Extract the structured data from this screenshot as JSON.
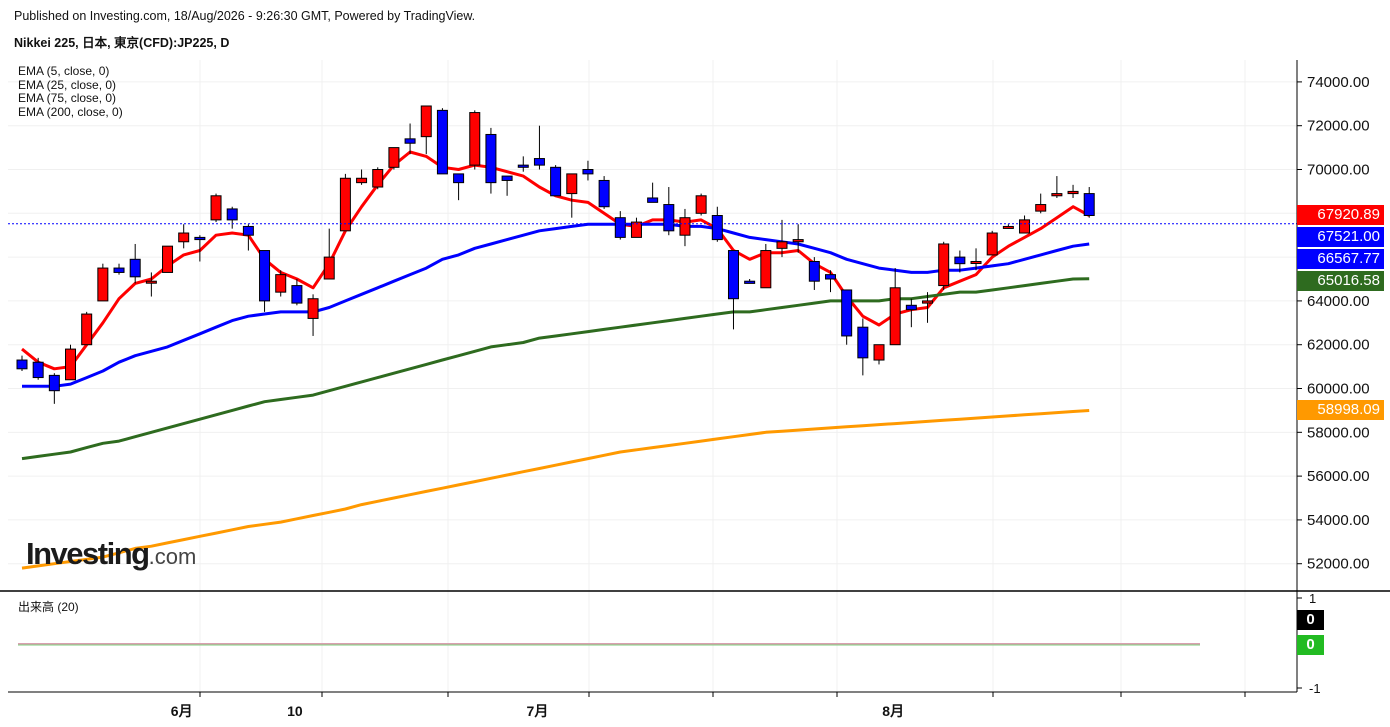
{
  "header": {
    "published": "Published on Investing.com, 18/Aug/2026 - 9:26:30 GMT, Powered by TradingView.",
    "symbol": "Nikkei 225, 日本, 東京(CFD):JP225, D"
  },
  "logo": {
    "text": "Investing",
    "suffix": ".com"
  },
  "chart_data": {
    "type": "candlestick",
    "y_axis": {
      "range": [
        50800,
        75000
      ],
      "ticks": [
        52000,
        54000,
        56000,
        58000,
        60000,
        62000,
        64000,
        66000,
        68000,
        70000,
        72000,
        74000
      ],
      "tick_labels": [
        "52000.00",
        "54000.00",
        "56000.00",
        "58000.00",
        "60000.00",
        "62000.00",
        "64000.00",
        "66000.00",
        "68000.00",
        "70000.00",
        "72000.00",
        "74000.00"
      ]
    },
    "x_axis": {
      "labels": [
        {
          "text": "6月",
          "index": 10
        },
        {
          "text": "10",
          "index": 17
        },
        {
          "text": "7月",
          "index": 32
        },
        {
          "text": "8月",
          "index": 54
        }
      ]
    },
    "candles": [
      {
        "o": 61300,
        "h": 61500,
        "l": 60800,
        "c": 60900
      },
      {
        "o": 61200,
        "h": 61400,
        "l": 60400,
        "c": 60500
      },
      {
        "o": 60600,
        "h": 60700,
        "l": 59300,
        "c": 59900
      },
      {
        "o": 60400,
        "h": 62000,
        "l": 60400,
        "c": 61800
      },
      {
        "o": 62000,
        "h": 63500,
        "l": 62000,
        "c": 63400
      },
      {
        "o": 64000,
        "h": 65700,
        "l": 64000,
        "c": 65500
      },
      {
        "o": 65500,
        "h": 65700,
        "l": 65200,
        "c": 65300
      },
      {
        "o": 65900,
        "h": 66600,
        "l": 64800,
        "c": 65100
      },
      {
        "o": 64900,
        "h": 65300,
        "l": 64200,
        "c": 64900
      },
      {
        "o": 65300,
        "h": 66400,
        "l": 65300,
        "c": 66500
      },
      {
        "o": 66700,
        "h": 67500,
        "l": 66400,
        "c": 67100
      },
      {
        "o": 66900,
        "h": 67000,
        "l": 65800,
        "c": 66800
      },
      {
        "o": 67700,
        "h": 68900,
        "l": 67600,
        "c": 68800
      },
      {
        "o": 68200,
        "h": 68300,
        "l": 67300,
        "c": 67700
      },
      {
        "o": 67400,
        "h": 67500,
        "l": 66300,
        "c": 67000
      },
      {
        "o": 66300,
        "h": 66300,
        "l": 63500,
        "c": 64000
      },
      {
        "o": 64400,
        "h": 65400,
        "l": 64200,
        "c": 65200
      },
      {
        "o": 64700,
        "h": 65000,
        "l": 63800,
        "c": 63900
      },
      {
        "o": 63200,
        "h": 64300,
        "l": 62400,
        "c": 64100
      },
      {
        "o": 65000,
        "h": 67300,
        "l": 65000,
        "c": 66000
      },
      {
        "o": 67200,
        "h": 69800,
        "l": 67200,
        "c": 69600
      },
      {
        "o": 69400,
        "h": 70000,
        "l": 69300,
        "c": 69600
      },
      {
        "o": 69200,
        "h": 70100,
        "l": 69100,
        "c": 70000
      },
      {
        "o": 70100,
        "h": 71000,
        "l": 70000,
        "c": 71000
      },
      {
        "o": 71400,
        "h": 72100,
        "l": 70700,
        "c": 71200
      },
      {
        "o": 71500,
        "h": 72900,
        "l": 70700,
        "c": 72900
      },
      {
        "o": 72700,
        "h": 72800,
        "l": 69800,
        "c": 69800
      },
      {
        "o": 69800,
        "h": 69800,
        "l": 68600,
        "c": 69400
      },
      {
        "o": 70200,
        "h": 72700,
        "l": 70000,
        "c": 72600
      },
      {
        "o": 71600,
        "h": 71900,
        "l": 68900,
        "c": 69400
      },
      {
        "o": 69700,
        "h": 69700,
        "l": 68800,
        "c": 69500
      },
      {
        "o": 70200,
        "h": 70600,
        "l": 69900,
        "c": 70100
      },
      {
        "o": 70500,
        "h": 72000,
        "l": 70000,
        "c": 70200
      },
      {
        "o": 70100,
        "h": 70200,
        "l": 68800,
        "c": 68800
      },
      {
        "o": 68900,
        "h": 69800,
        "l": 67800,
        "c": 69800
      },
      {
        "o": 70000,
        "h": 70400,
        "l": 69500,
        "c": 69800
      },
      {
        "o": 69500,
        "h": 69700,
        "l": 68200,
        "c": 68300
      },
      {
        "o": 67800,
        "h": 68100,
        "l": 66800,
        "c": 66900
      },
      {
        "o": 66900,
        "h": 67800,
        "l": 66900,
        "c": 67600
      },
      {
        "o": 68700,
        "h": 69400,
        "l": 68600,
        "c": 68500
      },
      {
        "o": 68400,
        "h": 69200,
        "l": 67000,
        "c": 67200
      },
      {
        "o": 67000,
        "h": 68200,
        "l": 66500,
        "c": 67800
      },
      {
        "o": 68000,
        "h": 68900,
        "l": 67900,
        "c": 68800
      },
      {
        "o": 67900,
        "h": 68300,
        "l": 66700,
        "c": 66800
      },
      {
        "o": 66300,
        "h": 66300,
        "l": 62700,
        "c": 64100
      },
      {
        "o": 64900,
        "h": 65000,
        "l": 64800,
        "c": 64800
      },
      {
        "o": 64600,
        "h": 66600,
        "l": 64600,
        "c": 66300
      },
      {
        "o": 66400,
        "h": 67700,
        "l": 66000,
        "c": 66700
      },
      {
        "o": 66700,
        "h": 67500,
        "l": 66200,
        "c": 66800
      },
      {
        "o": 65800,
        "h": 66000,
        "l": 64500,
        "c": 64900
      },
      {
        "o": 65200,
        "h": 65400,
        "l": 64400,
        "c": 65000
      },
      {
        "o": 64500,
        "h": 64500,
        "l": 62000,
        "c": 62400
      },
      {
        "o": 62800,
        "h": 63200,
        "l": 60600,
        "c": 61400
      },
      {
        "o": 61300,
        "h": 61600,
        "l": 61100,
        "c": 62000
      },
      {
        "o": 62000,
        "h": 65500,
        "l": 62000,
        "c": 64600
      },
      {
        "o": 63800,
        "h": 64100,
        "l": 62800,
        "c": 63600
      },
      {
        "o": 63900,
        "h": 64400,
        "l": 63000,
        "c": 64000
      },
      {
        "o": 64700,
        "h": 66700,
        "l": 64500,
        "c": 66600
      },
      {
        "o": 66000,
        "h": 66300,
        "l": 65300,
        "c": 65700
      },
      {
        "o": 65800,
        "h": 66400,
        "l": 65400,
        "c": 65800
      },
      {
        "o": 66100,
        "h": 67200,
        "l": 66100,
        "c": 67100
      },
      {
        "o": 67400,
        "h": 67500,
        "l": 67300,
        "c": 67400
      },
      {
        "o": 67100,
        "h": 67900,
        "l": 67100,
        "c": 67700
      },
      {
        "o": 68100,
        "h": 68900,
        "l": 68000,
        "c": 68400
      },
      {
        "o": 68800,
        "h": 69700,
        "l": 68700,
        "c": 68900
      },
      {
        "o": 68900,
        "h": 69300,
        "l": 68700,
        "c": 69000
      },
      {
        "o": 68900,
        "h": 69200,
        "l": 67800,
        "c": 67900
      }
    ],
    "series": [
      {
        "name": "EMA (5, close, 0)",
        "color": "#ff0000",
        "last": 67920.89,
        "last_label": "67920.89",
        "values": [
          61800,
          61200,
          60900,
          61000,
          62000,
          63000,
          64100,
          64800,
          65000,
          65600,
          66100,
          66300,
          67000,
          67100,
          67000,
          65900,
          65300,
          65000,
          64600,
          65700,
          67200,
          68300,
          69300,
          70200,
          70800,
          70600,
          70100,
          70000,
          70200,
          70100,
          69900,
          69700,
          69200,
          68800,
          68600,
          68500,
          68000,
          67500,
          67400,
          67700,
          67700,
          67600,
          67700,
          67300,
          66300,
          65900,
          66200,
          66200,
          66300,
          65700,
          65300,
          64200,
          63300,
          62900,
          63400,
          63600,
          63700,
          64600,
          64900,
          65200,
          66000,
          66500,
          66900,
          67300,
          67800,
          68300,
          67900
        ]
      },
      {
        "name": "EMA (25, close, 0)",
        "color": "#0000ff",
        "last": 66567.77,
        "last_label": "66567.77",
        "values": [
          60100,
          60100,
          60100,
          60200,
          60500,
          60800,
          61200,
          61500,
          61700,
          61900,
          62200,
          62500,
          62800,
          63100,
          63300,
          63400,
          63500,
          63500,
          63500,
          63700,
          64000,
          64300,
          64600,
          64900,
          65200,
          65500,
          65900,
          66100,
          66400,
          66600,
          66800,
          67000,
          67200,
          67300,
          67400,
          67500,
          67500,
          67500,
          67500,
          67500,
          67500,
          67400,
          67400,
          67300,
          67100,
          66900,
          66800,
          66700,
          66600,
          66400,
          66200,
          65900,
          65700,
          65500,
          65400,
          65300,
          65300,
          65400,
          65400,
          65500,
          65600,
          65700,
          65900,
          66100,
          66300,
          66500,
          66600
        ]
      },
      {
        "name": "EMA (75, close, 0)",
        "color": "#2e6b1f",
        "last": 65016.58,
        "last_label": "65016.58",
        "values": [
          56800,
          56900,
          57000,
          57100,
          57300,
          57500,
          57600,
          57800,
          58000,
          58200,
          58400,
          58600,
          58800,
          59000,
          59200,
          59400,
          59500,
          59600,
          59700,
          59900,
          60100,
          60300,
          60500,
          60700,
          60900,
          61100,
          61300,
          61500,
          61700,
          61900,
          62000,
          62100,
          62300,
          62400,
          62500,
          62600,
          62700,
          62800,
          62900,
          63000,
          63100,
          63200,
          63300,
          63400,
          63500,
          63500,
          63600,
          63700,
          63800,
          63900,
          64000,
          64000,
          64000,
          64000,
          64100,
          64100,
          64200,
          64300,
          64400,
          64400,
          64500,
          64600,
          64700,
          64800,
          64900,
          65000,
          65016
        ]
      },
      {
        "name": "EMA (200, close, 0)",
        "color": "#ff9900",
        "last": 58998.09,
        "last_label": "58998.09",
        "values": [
          51800,
          51900,
          52000,
          52100,
          52200,
          52300,
          52500,
          52700,
          52800,
          52950,
          53100,
          53250,
          53400,
          53550,
          53700,
          53800,
          53900,
          54050,
          54200,
          54350,
          54500,
          54700,
          54850,
          55000,
          55150,
          55300,
          55450,
          55600,
          55750,
          55900,
          56050,
          56200,
          56350,
          56500,
          56650,
          56800,
          56950,
          57100,
          57200,
          57300,
          57400,
          57500,
          57600,
          57700,
          57800,
          57900,
          58000,
          58050,
          58100,
          58150,
          58200,
          58250,
          58300,
          58350,
          58400,
          58450,
          58500,
          58550,
          58600,
          58650,
          58700,
          58750,
          58800,
          58850,
          58900,
          58950,
          58998
        ]
      }
    ],
    "current_price": {
      "value": 67521.0,
      "label": "67521.00",
      "color": "#0000ff"
    },
    "volume": {
      "name": "出来高 (20)",
      "y_ticks": [
        "1",
        "0",
        "-1"
      ],
      "last_labels": [
        {
          "text": "0",
          "color": "#000000"
        },
        {
          "text": "0",
          "color": "#22bb22"
        }
      ]
    },
    "colors": {
      "up": "#ff0000",
      "down": "#0000ff",
      "grid": "#f0f0f0",
      "axis": "#000000"
    }
  }
}
